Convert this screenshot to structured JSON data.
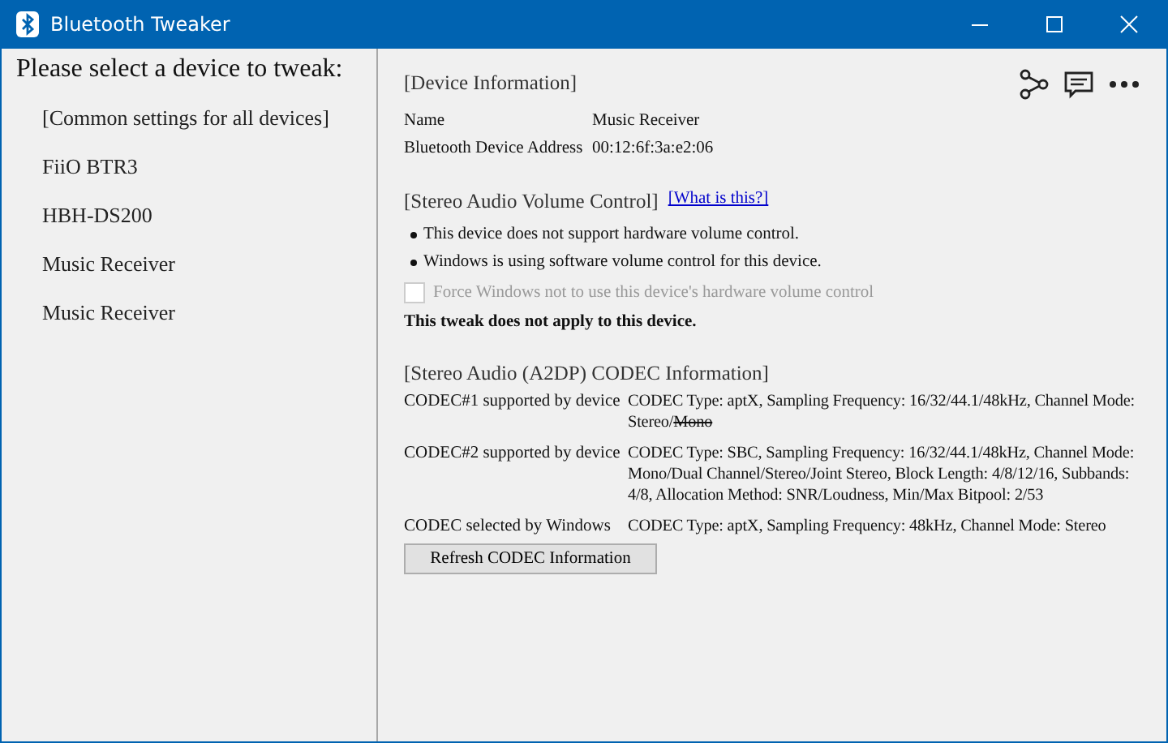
{
  "window": {
    "title": "Bluetooth Tweaker"
  },
  "sidebar": {
    "prompt": "Please select a device to tweak:",
    "items": [
      {
        "label": "[Common settings for all devices]",
        "selected": false
      },
      {
        "label": "FiiO BTR3",
        "selected": false
      },
      {
        "label": "HBH-DS200",
        "selected": false
      },
      {
        "label": "Music Receiver",
        "selected": false
      },
      {
        "label": "Music Receiver",
        "selected": false
      }
    ]
  },
  "device_information": {
    "heading": "[Device Information]",
    "rows": [
      {
        "label": "Name",
        "value": "Music Receiver"
      },
      {
        "label": "Bluetooth Device Address",
        "value": "00:12:6f:3a:e2:06"
      }
    ]
  },
  "volume_control": {
    "heading": "[Stereo Audio Volume Control]",
    "link": "[What is this?]",
    "bullets": [
      "This device does not support hardware volume control.",
      "Windows is using software volume control for this device."
    ],
    "checkbox": {
      "label": "Force Windows not to use this device's hardware volume control",
      "checked": false,
      "disabled": true
    },
    "note": "This tweak does not apply to this device."
  },
  "codec_information": {
    "heading": "[Stereo Audio (A2DP) CODEC Information]",
    "rows": [
      {
        "label": "CODEC#1 supported by device",
        "value": [
          {
            "text": "CODEC Type: aptX, Sampling Frequency: 16/32/44.1/48kHz, Channel Mode: Stereo/",
            "struck": false
          },
          {
            "text": "Mono",
            "struck": true
          }
        ]
      },
      {
        "label": "CODEC#2 supported by device",
        "value": [
          {
            "text": "CODEC Type: SBC, Sampling Frequency: 16/32/44.1/48kHz, Channel Mode: Mono/Dual Channel/Stereo/Joint Stereo, Block Length: 4/8/12/16, Subbands: 4/8, Allocation Method: SNR/Loudness, Min/Max Bitpool: 2/53",
            "struck": false
          }
        ]
      },
      {
        "label": "CODEC selected by Windows",
        "value": [
          {
            "text": "CODEC Type: aptX, Sampling Frequency: 48kHz, Channel Mode: Stereo",
            "struck": false
          }
        ]
      }
    ],
    "button": "Refresh CODEC Information"
  }
}
